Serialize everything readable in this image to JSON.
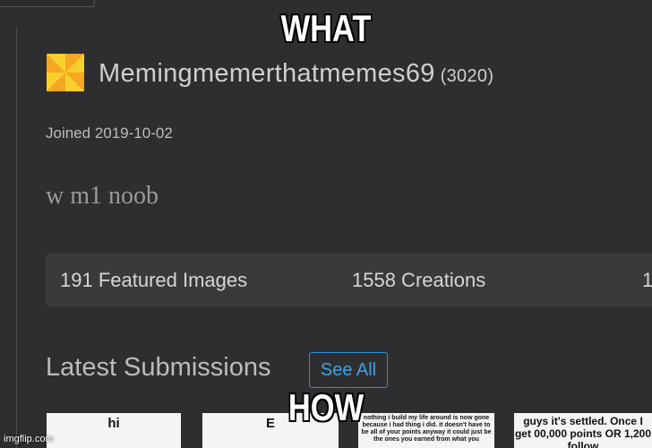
{
  "meme": {
    "top_text": "WHAT",
    "bottom_text": "HOW",
    "watermark": "imgflip.com"
  },
  "profile": {
    "username": "Memingmemerthatmemes69",
    "points": "(3020)",
    "joined": "Joined 2019-10-02",
    "bio": "w m1 noob",
    "avatar_icon": "pinwheel-avatar-icon",
    "avatar_colors": [
      "#f5a623",
      "#f7d02c"
    ]
  },
  "stats": {
    "featured": "191 Featured Images",
    "creations": "1558 Creations",
    "truncated": "1"
  },
  "submissions": {
    "title": "Latest Submissions",
    "see_all": "See All",
    "accent_color": "#3ea3e8",
    "thumbnails": [
      {
        "text": "hi"
      },
      {
        "text": "E"
      },
      {
        "text": "nothing i build my life around is now gone because i had thing i did. it doesn't have to be all of your points anyway it could just be the ones you earned from what you"
      },
      {
        "text": "guys it's settled. Once I get 00,000 points OR 1,200 follow"
      }
    ]
  }
}
